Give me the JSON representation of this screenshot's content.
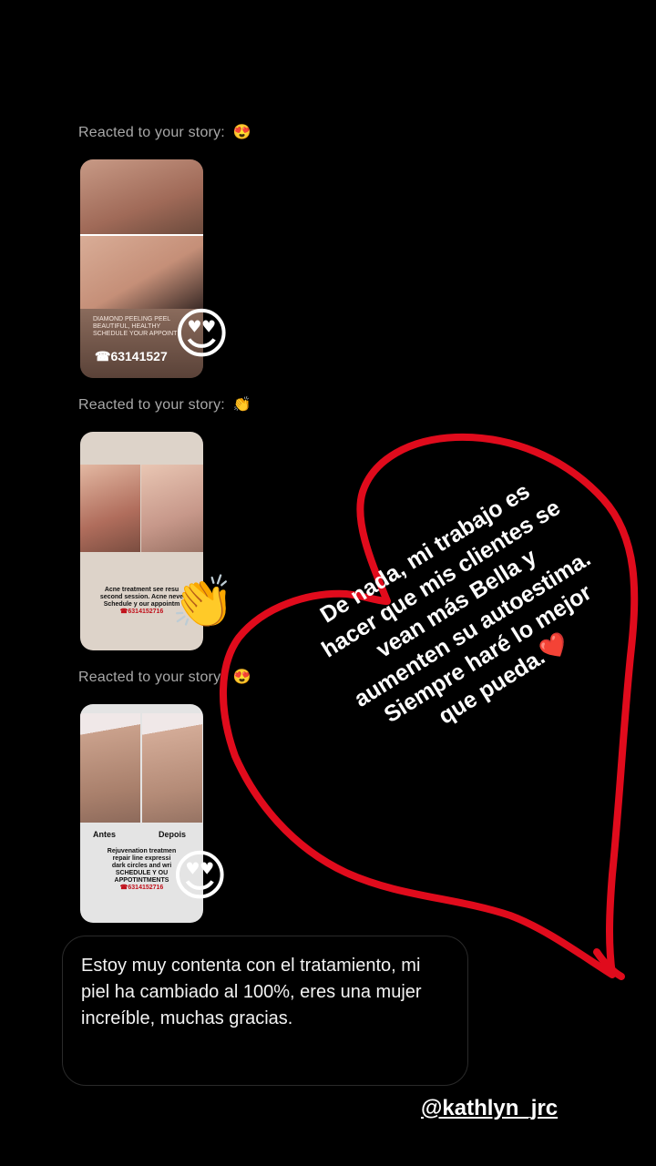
{
  "reactions": [
    {
      "label": "Reacted to your story:",
      "emoji": "😍"
    },
    {
      "label": "Reacted to your story:",
      "emoji": "👏"
    },
    {
      "label": "Reacted to your story:",
      "emoji": "😍"
    }
  ],
  "stories": [
    {
      "caption_lines": [
        "DIAMOND PEELING PEEL",
        "BEAUTIFUL, HEALTHY",
        "SCHEDULE YOUR APPOINT"
      ],
      "phone": "☎63141527",
      "reaction_emoji": "😍"
    },
    {
      "caption_lines": [
        "Acne treatment see resu",
        "second session. Acne neve",
        "Schedule y our appointm",
        "☎6314152716"
      ],
      "reaction_emoji": "👏"
    },
    {
      "labels": [
        "Antes",
        "Depois"
      ],
      "caption_lines": [
        "Rejuvenation treatmen",
        "repair line expressi",
        "dark circles and wri",
        "SCHEDULE Y OU",
        "APPOTINTMENTS",
        "☎6314152716"
      ],
      "reaction_emoji": "😍"
    }
  ],
  "message": {
    "text": "Estoy muy contenta con el tratamiento, mi piel ha cambiado al 100%, eres una mujer increíble, muchas gracias."
  },
  "overlay": {
    "text": "De nada, mi trabajo es\nhacer que mis clientes se\nvean más Bella y\naumenten su autoestima.\nSiempre haré lo mejor\nque pueda.❤️",
    "heart_color": "#e00b1c"
  },
  "handle": "@kathlyn_jrc"
}
